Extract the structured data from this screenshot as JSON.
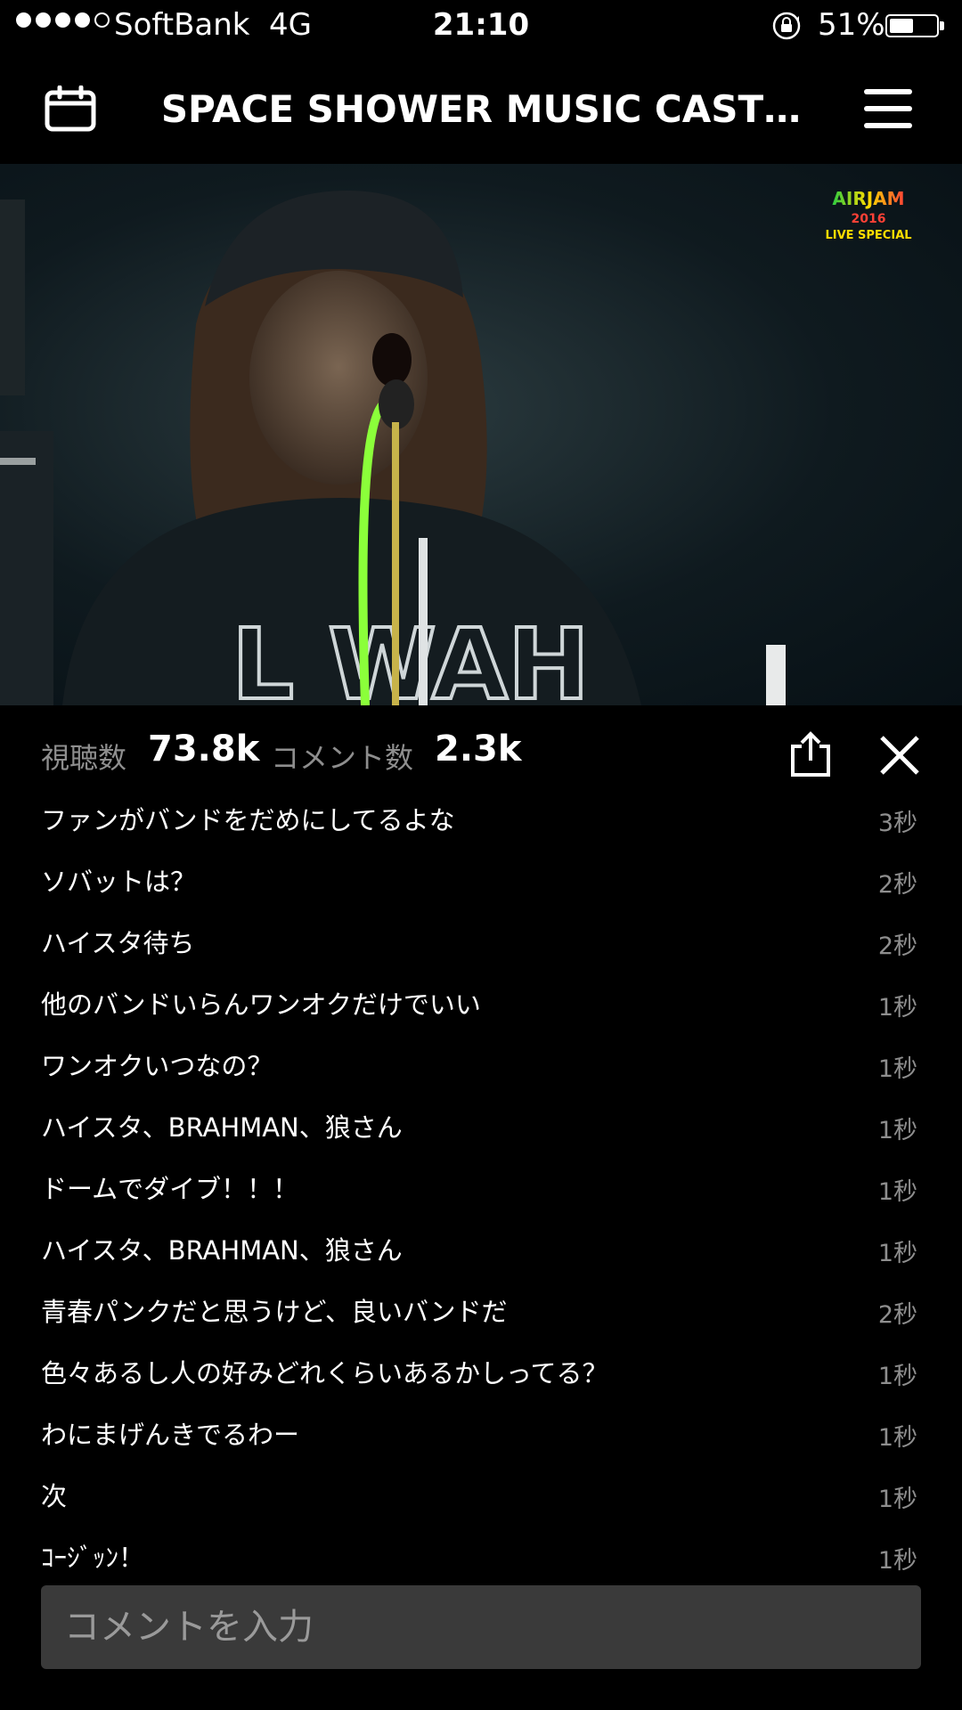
{
  "status_bar": {
    "carrier": "SoftBank",
    "network": "4G",
    "time": "21:10",
    "battery_percent": "51%",
    "battery_level": 0.51,
    "signal_bars_filled": 4,
    "signal_bars_total": 5
  },
  "nav": {
    "title": "SPACE SHOWER MUSIC CAST…"
  },
  "video": {
    "overlay_logo": "AIRJAM 2016 LIVE SPECIAL"
  },
  "stats": {
    "views_label": "視聴数",
    "views_value": "73.8k",
    "comments_label": "コメント数",
    "comments_value": "2.3k"
  },
  "comments": [
    {
      "text": "ファンがバンドをだめにしてるよな",
      "time": "3秒"
    },
    {
      "text": "ソバットは？",
      "time": "2秒"
    },
    {
      "text": "ハイスタ待ち",
      "time": "2秒"
    },
    {
      "text": "他のバンドいらんワンオクだけでいい",
      "time": "1秒"
    },
    {
      "text": "ワンオクいつなの？",
      "time": "1秒"
    },
    {
      "text": "ハイスタ、BRAHMAN、狼さん",
      "time": "1秒"
    },
    {
      "text": "ドームでダイブ！！！",
      "time": "1秒"
    },
    {
      "text": "ハイスタ、BRAHMAN、狼さん",
      "time": "1秒"
    },
    {
      "text": "青春パンクだと思うけど、良いバンドだ",
      "time": "2秒"
    },
    {
      "text": "色々あるし人の好みどれくらいあるかしってる？",
      "time": "1秒"
    },
    {
      "text": "わにまげんきでるわー",
      "time": "1秒"
    },
    {
      "text": "次",
      "time": "1秒"
    },
    {
      "text": "ｺｰｼﾞｯﾝ！",
      "time": "1秒"
    }
  ],
  "comment_input": {
    "placeholder": "コメントを入力"
  },
  "icons": {
    "calendar": "calendar-icon",
    "menu": "menu-icon",
    "share": "share-icon",
    "close": "close-icon",
    "orientation_lock": "orientation-lock-icon"
  },
  "colors": {
    "background": "#000000",
    "secondary_text": "#8e8e8e",
    "input_background": "#3a3a3a"
  }
}
